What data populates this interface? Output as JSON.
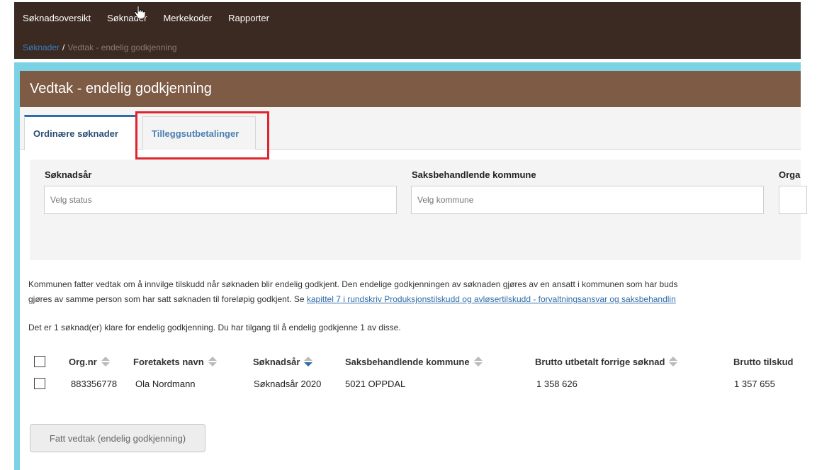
{
  "nav": {
    "items": [
      "Søknadsoversikt",
      "Søknader",
      "Merkekoder",
      "Rapporter"
    ]
  },
  "breadcrumb": {
    "link": "Søknader",
    "separator": "/",
    "current": "Vedtak - endelig godkjenning"
  },
  "page": {
    "title": "Vedtak - endelig godkjenning"
  },
  "tabs": [
    {
      "label": "Ordinære søknader",
      "active": true
    },
    {
      "label": "Tilleggsutbetalinger",
      "active": false
    }
  ],
  "filters": {
    "year": {
      "label": "Søknadsår",
      "placeholder": "Velg status"
    },
    "municipality": {
      "label": "Saksbehandlende kommune",
      "placeholder": "Velg kommune"
    },
    "org": {
      "label": "Orga"
    }
  },
  "info": {
    "line1": "Kommunen fatter vedtak om å innvilge tilskudd når søknaden blir endelig godkjent. Den endelige godkjenningen av søknaden gjøres av en ansatt i kommunen som har buds",
    "line2_prefix": "gjøres av samme person som har satt søknaden til foreløpig godkjent. Se ",
    "line2_link": "kapittel 7 i rundskriv Produksjonstilskudd og avløsertilskudd - forvaltningsansvar og saksbehandlin"
  },
  "count_text": "Det er 1 søknad(er) klare for endelig godkjenning. Du har tilgang til å endelig godkjenne 1 av disse.",
  "table": {
    "columns": [
      "Org.nr",
      "Foretakets navn",
      "Søknadsår",
      "Saksbehandlende kommune",
      "Brutto utbetalt forrige søknad",
      "Brutto tilskud"
    ],
    "rows": [
      [
        "883356778",
        "Ola Nordmann",
        "Søknadsår 2020",
        "5021 OPPDAL",
        "1 358 626",
        "1 357 655"
      ]
    ]
  },
  "submit_button": "Fatt vedtak (endelig godkjenning)",
  "colors": {
    "topbar": "#3b2a22",
    "header": "#7e5b45",
    "accent_cyan": "#7ad2e4",
    "link_blue": "#2f6ca8",
    "highlight_red": "#e0242d"
  }
}
